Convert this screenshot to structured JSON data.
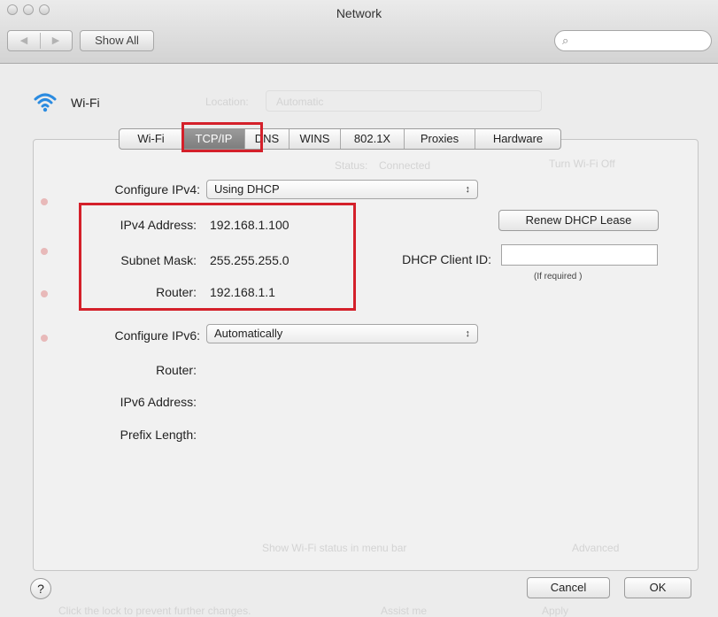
{
  "window": {
    "title": "Network"
  },
  "toolbar": {
    "back_icon": "◀",
    "forward_icon": "▶",
    "show_all": "Show All",
    "search_icon": "search-icon",
    "search_placeholder": ""
  },
  "service": {
    "name": "Wi-Fi"
  },
  "background": {
    "location_label": "Location:",
    "location_value": "Automatic",
    "status_label": "Status:",
    "status_value": "Connected",
    "turn_off_button": "Turn Wi-Fi Off",
    "show_status": "Show Wi-Fi status in menu bar",
    "advanced_button": "Advanced",
    "lock_text": "Click the lock to prevent further changes.",
    "assist_button": "Assist me",
    "apply_button": "Apply"
  },
  "tabs": [
    {
      "label": "Wi-Fi",
      "active": false
    },
    {
      "label": "TCP/IP",
      "active": true
    },
    {
      "label": "DNS",
      "active": false
    },
    {
      "label": "WINS",
      "active": false
    },
    {
      "label": "802.1X",
      "active": false
    },
    {
      "label": "Proxies",
      "active": false
    },
    {
      "label": "Hardware",
      "active": false
    }
  ],
  "ipv4": {
    "configure_label": "Configure IPv4:",
    "configure_value": "Using DHCP",
    "address_label": "IPv4 Address:",
    "address_value": "192.168.1.100",
    "subnet_label": "Subnet Mask:",
    "subnet_value": "255.255.255.0",
    "router_label": "Router:",
    "router_value": "192.168.1.1"
  },
  "dhcp": {
    "renew_button": "Renew DHCP Lease",
    "client_id_label": "DHCP Client ID:",
    "client_id_value": "",
    "client_id_note": "(If required )"
  },
  "ipv6": {
    "configure_label": "Configure IPv6:",
    "configure_value": "Automatically",
    "router_label": "Router:",
    "address_label": "IPv6 Address:",
    "prefix_label": "Prefix Length:"
  },
  "footer": {
    "help": "?",
    "cancel": "Cancel",
    "ok": "OK"
  },
  "colors": {
    "highlight": "#d4202a",
    "wifi_blue": "#2b8be0"
  }
}
